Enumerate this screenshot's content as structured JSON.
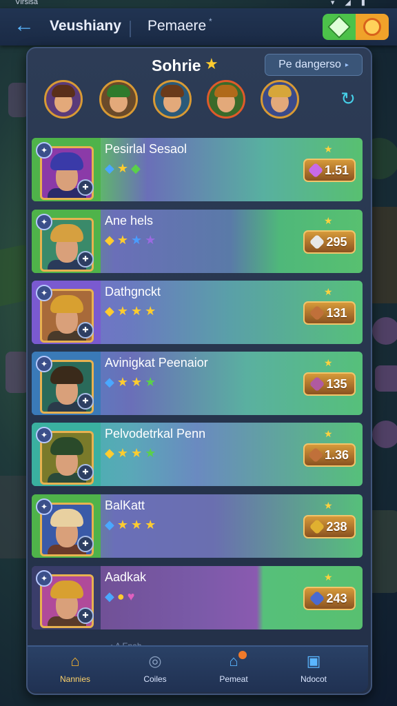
{
  "statusbar": {
    "left": "Vlrsisa",
    "right": "▾ ◢ ▮"
  },
  "topbar": {
    "back_icon": "back-arrow-icon",
    "tab1": "Veushiany",
    "tab2": "Pemaere",
    "tab2_mark": "*",
    "toggle_left_icon": "gem-icon",
    "toggle_right_icon": "coin-icon"
  },
  "panel": {
    "title": "Sohrie",
    "title_star": "★",
    "sort_label": "Pe dangerso",
    "sort_arrow": "▸",
    "refresh_icon": "↻"
  },
  "avatars": [
    {
      "name": "avatar-1",
      "hair": "#5a2f1a",
      "frame": "#d89a34",
      "bg": "#5a3b7a"
    },
    {
      "name": "avatar-2",
      "hair": "#2e7a2c",
      "frame": "#d89a34",
      "bg": "#6a4a2a"
    },
    {
      "name": "avatar-3",
      "hair": "#6a3a1a",
      "frame": "#d89a34",
      "bg": "#2a5a7a"
    },
    {
      "name": "avatar-4",
      "hair": "#b06a1a",
      "frame": "#e05a2a",
      "bg": "#3a6a2a"
    },
    {
      "name": "avatar-5",
      "hair": "#d6a63a",
      "frame": "#d89a34",
      "bg": "#3a4a8a"
    }
  ],
  "rows": [
    {
      "name": "Pesirlal Sesaol",
      "stars": [
        "◆",
        "★",
        "◆"
      ],
      "star_colors": [
        "#4aa8ff",
        "#ffcc2f",
        "#5ad04a"
      ],
      "price": "1.51",
      "price_icon_color": "#c86ae8",
      "bg": "linear-gradient(90deg,#56b94e 0%,#5fb86a 20%,#6a6fb8 35%,#58b0a0 70%,#58c070 100%)",
      "frame_bg": "#4fb34a",
      "portrait_bg": "#8b3aa8",
      "hair": "#3a3aa8",
      "body": "#2a2a6a"
    },
    {
      "name": "Ane hels",
      "stars": [
        "◆",
        "★",
        "★",
        "★"
      ],
      "star_colors": [
        "#ffcc2f",
        "#ffcc2f",
        "#4a9cff",
        "#9a6ae0"
      ],
      "price": "295",
      "price_icon_color": "#e8e8e8",
      "bg": "linear-gradient(90deg,#56b94e 0%,#6a6fb8 25%,#5a7aa8 60%,#4fb87a 75%,#58c070 100%)",
      "frame_bg": "#4fb34a",
      "portrait_bg": "#3a8a6a",
      "hair": "#d6a040",
      "body": "#2a3a5a"
    },
    {
      "name": "Dathgnckt",
      "stars": [
        "◆",
        "★",
        "★",
        "★"
      ],
      "star_colors": [
        "#ffcc2f",
        "#ffcc2f",
        "#ffcc2f",
        "#ffcc2f"
      ],
      "price": "131",
      "price_icon_color": "#c0703a",
      "bg": "linear-gradient(90deg,#7a6ad0 0%,#6a7ac0 30%,#5aa0a8 60%,#56c07a 100%)",
      "frame_bg": "#7a5ad0",
      "portrait_bg": "#a86a3a",
      "hair": "#d8a030",
      "body": "#4a3a2a"
    },
    {
      "name": "Avinigkat Peenaior",
      "stars": [
        "◆",
        "★",
        "★",
        "★"
      ],
      "star_colors": [
        "#4aa8ff",
        "#ffcc2f",
        "#ffcc2f",
        "#5ad04a"
      ],
      "price": "135",
      "price_icon_color": "#b05aa0",
      "bg": "linear-gradient(90deg,#4a8ac8 0%,#6a6fb8 30%,#5ab0a0 65%,#56c07a 100%)",
      "frame_bg": "#3a7ab8",
      "portrait_bg": "#2a6a5a",
      "hair": "#3a2a1a",
      "body": "#2a3a4a"
    },
    {
      "name": "Pelvodetrkal Penn",
      "stars": [
        "◆",
        "★",
        "★",
        "★"
      ],
      "star_colors": [
        "#ffcc2f",
        "#ffcc2f",
        "#ffcc2f",
        "#5ad04a"
      ],
      "price": "1.36",
      "price_icon_color": "#c0703a",
      "bg": "linear-gradient(90deg,#3ab8a8 0%,#5aa8b8 30%,#6a8ac0 50%,#56c07a 100%)",
      "frame_bg": "#3ab0a0",
      "portrait_bg": "#7a7a2a",
      "hair": "#2a4a2a",
      "body": "#2a4a3a"
    },
    {
      "name": "BalKatt",
      "stars": [
        "◆",
        "★",
        "★",
        "★"
      ],
      "star_colors": [
        "#4aa8ff",
        "#ffcc2f",
        "#ffcc2f",
        "#ffcc2f"
      ],
      "price": "238",
      "price_icon_color": "#e0b030",
      "bg": "linear-gradient(90deg,#56b94e 0%,#6a6fb8 25%,#6a6fb0 55%,#56c07a 100%)",
      "frame_bg": "#4fb34a",
      "portrait_bg": "#3a5aa8",
      "hair": "#e8d0a0",
      "body": "#6a3a2a"
    },
    {
      "name": "Aadkak",
      "stars": [
        "◆",
        "●",
        "♥"
      ],
      "star_colors": [
        "#4aa8ff",
        "#ffcc2f",
        "#e060c0"
      ],
      "price": "243",
      "price_icon_color": "#4a6ad0",
      "bg": "linear-gradient(90deg,#6a4a8a 0%,#7a5aa8 50%,#8a5ab0 68%,#56c07a 70%,#58c070 100%)",
      "frame_bg": "#3a3d6a",
      "portrait_bg": "#b04a9a",
      "hair": "#d8a030",
      "body": "#5a3a2a"
    }
  ],
  "more_text": "• A Enah",
  "nav": [
    {
      "label": "Nannies",
      "icon": "home-icon",
      "glyph": "⌂",
      "color": "#f0b030",
      "active": true
    },
    {
      "label": "Coiles",
      "icon": "globe-icon",
      "glyph": "◎",
      "color": "#8aa0c0",
      "active": false
    },
    {
      "label": "Pemeat",
      "icon": "shop-icon",
      "glyph": "⌂",
      "color": "#5ab6ff",
      "active": false,
      "dot": true
    },
    {
      "label": "Ndocot",
      "icon": "inbox-icon",
      "glyph": "▣",
      "color": "#5ab6ff",
      "active": false
    }
  ]
}
